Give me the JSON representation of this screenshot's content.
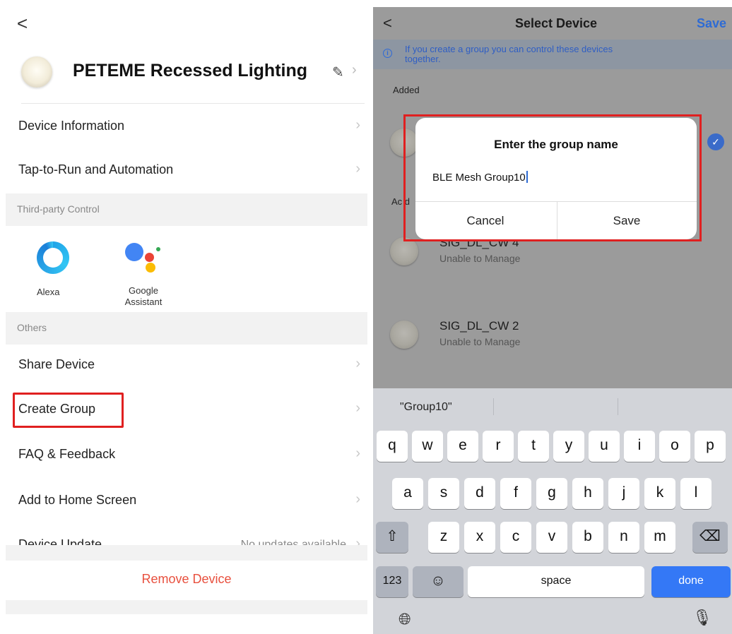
{
  "left": {
    "back_glyph": "<",
    "device_title": "PETEME Recessed Lighting",
    "menu1": [
      {
        "label": "Device Information"
      },
      {
        "label": "Tap-to-Run and Automation"
      }
    ],
    "section_third": "Third-party Control",
    "alexa_label": "Alexa",
    "google_label_1": "Google",
    "google_label_2": "Assistant",
    "section_others": "Others",
    "menu2": [
      {
        "label": "Share Device"
      },
      {
        "label": "Create Group"
      },
      {
        "label": "FAQ & Feedback"
      },
      {
        "label": "Add to Home Screen"
      },
      {
        "label": "Device Update",
        "value": "No updates available"
      }
    ],
    "remove_label": "Remove Device"
  },
  "right": {
    "nav": {
      "back": "<",
      "title": "Select Device",
      "save": "Save"
    },
    "info_text": "If you create a group you can control these devices together.",
    "added_label": "Added",
    "add_peek": "Ac d",
    "dialog": {
      "title": "Enter the group name",
      "input_value": "BLE Mesh Group10",
      "cancel": "Cancel",
      "save": "Save"
    },
    "devices": [
      {
        "name": "SIG_DL_CW 4",
        "status": "Unable to Manage"
      },
      {
        "name": "SIG_DL_CW 2",
        "status": "Unable to Manage"
      }
    ],
    "keyboard": {
      "suggestion": "\"Group10\"",
      "row1": [
        "q",
        "w",
        "e",
        "r",
        "t",
        "y",
        "u",
        "i",
        "o",
        "p"
      ],
      "row2": [
        "a",
        "s",
        "d",
        "f",
        "g",
        "h",
        "j",
        "k",
        "l"
      ],
      "row3": [
        "z",
        "x",
        "c",
        "v",
        "b",
        "n",
        "m"
      ],
      "numbers": "123",
      "space": "space",
      "done": "done"
    }
  },
  "colors": {
    "accent_blue": "#2e6bd4",
    "highlight_red": "#e02020",
    "remove_red": "#e8503e"
  }
}
